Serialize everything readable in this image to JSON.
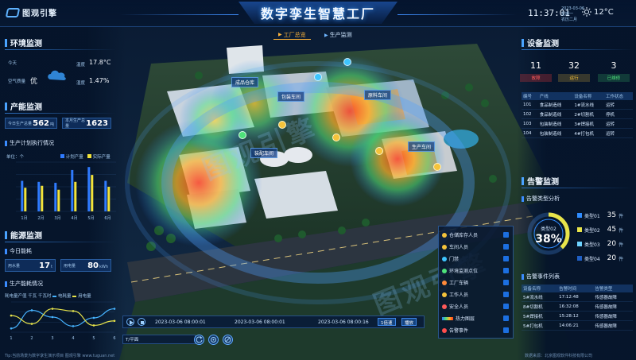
{
  "header": {
    "logo_text": "图观引擎",
    "title": "数字孪生智慧工厂",
    "time": "11:37:01",
    "date_lines": [
      "2023-03-06",
      "星期一",
      "农历二月"
    ],
    "temperature": "12°C"
  },
  "nav": {
    "tabs": [
      {
        "label": "工厂总览",
        "active": true
      },
      {
        "label": "生产监测",
        "active": false
      }
    ]
  },
  "env": {
    "title": "环境监测",
    "items": [
      {
        "label": "今天",
        "value": ""
      },
      {
        "label": "空气质量",
        "value": "优"
      },
      {
        "label": "温度",
        "value": "17.8°C"
      },
      {
        "label": "湿度",
        "value": "1.47%"
      }
    ]
  },
  "capacity": {
    "title": "产能监测",
    "today_label": "今日生产总量",
    "today_value": "562",
    "today_unit": "吨",
    "month_label": "本月生产总量",
    "month_value": "1623",
    "plan_title": "生产计划执行情况",
    "unit_label": "单位：个",
    "legend": [
      "计划产量",
      "实际产量"
    ]
  },
  "chart_bar": {
    "type": "bar",
    "categories": [
      "1月",
      "2月",
      "3月",
      "4月",
      "5月",
      "6月"
    ],
    "series": [
      {
        "name": "计划产量",
        "values": [
          62,
          60,
          58,
          84,
          90,
          62
        ]
      },
      {
        "name": "实际产量",
        "values": [
          48,
          52,
          44,
          60,
          74,
          50
        ]
      }
    ],
    "ylim": [
      0,
      100
    ],
    "colors": [
      "#2f7bff",
      "#f2e33a"
    ]
  },
  "energy": {
    "title": "能源监测",
    "today_title": "今日能耗",
    "water_label": "用水量",
    "water_value": "17",
    "water_unit": "t",
    "power_label": "用电量",
    "power_value": "80",
    "power_unit": "kWh",
    "trend_title": "生产能耗情况",
    "legend_left": "耗电量产值",
    "unit_left": "千瓦",
    "unit_right": "千瓦时",
    "legend": [
      "电耗量",
      "用电量"
    ]
  },
  "chart_line": {
    "type": "line",
    "x": [
      1,
      2,
      3,
      4,
      5,
      6
    ],
    "series": [
      {
        "name": "电耗量",
        "values": [
          10,
          58,
          40,
          16,
          38,
          62
        ]
      },
      {
        "name": "用电量",
        "values": [
          44,
          22,
          62,
          56,
          18,
          30
        ]
      }
    ],
    "ylim": [
      0,
      80
    ],
    "colors": [
      "#46b3ff",
      "#e8e44a"
    ]
  },
  "devices": {
    "title": "设备监测",
    "stats": [
      {
        "value": "11",
        "label": "故障",
        "tone": "red"
      },
      {
        "value": "32",
        "label": "运行",
        "tone": "yellow"
      },
      {
        "value": "3",
        "label": "已维修",
        "tone": "green"
      }
    ],
    "table_headers": [
      "编号",
      "产线",
      "设备名称",
      "工作状态"
    ],
    "table_rows": [
      [
        "101",
        "食品制造线",
        "1#流水线",
        "运转"
      ],
      [
        "102",
        "食品制造线",
        "2#切割机",
        "停机"
      ],
      [
        "103",
        "包装制造线",
        "3#焊接机",
        "运转"
      ],
      [
        "104",
        "包装制造线",
        "4#打包机",
        "运转"
      ]
    ]
  },
  "alarm": {
    "title": "告警监测",
    "type_title": "告警类型分析",
    "ring_label": "类型02",
    "ring_percent": "38%",
    "ring_fraction": 0.38,
    "types": [
      {
        "label": "类型01",
        "value": "35",
        "unit": "件",
        "color": "#2f8cff"
      },
      {
        "label": "类型02",
        "value": "45",
        "unit": "件",
        "color": "#e8e44a"
      },
      {
        "label": "类型03",
        "value": "20",
        "unit": "件",
        "color": "#6ed2ff"
      },
      {
        "label": "类型04",
        "value": "20",
        "unit": "件",
        "color": "#1f5fc4"
      }
    ],
    "list_title": "告警事件列表",
    "list_headers": [
      "设备名称",
      "告警时间",
      "告警类型"
    ],
    "list_rows": [
      [
        "5#流水线",
        "17:12:48",
        "传感器故障"
      ],
      [
        "8#切割机",
        "16:32:08",
        "传感器故障"
      ],
      [
        "5#焊接机",
        "15:28:12",
        "传感器故障"
      ],
      [
        "5#打包机",
        "14:06:21",
        "传感器故障"
      ]
    ]
  },
  "map": {
    "labels": [
      "成品仓库",
      "包装车间",
      "原料车间",
      "装配车间",
      "生产车间"
    ],
    "watermark": "图观引擎"
  },
  "legend_panel": {
    "items": [
      {
        "label": "仓储库存人员",
        "color": "#f5c33b"
      },
      {
        "label": "车间人员",
        "color": "#f5c33b"
      },
      {
        "label": "门禁",
        "color": "#3ec5ff"
      },
      {
        "label": "环境监测点位",
        "color": "#4ee27a"
      },
      {
        "label": "工厂车辆",
        "color": "#ff8a3a"
      },
      {
        "label": "工作人员",
        "color": "#f5c33b"
      },
      {
        "label": "安全人员",
        "color": "#ff5a5a"
      },
      {
        "label": "热力图层",
        "color": "#ff4d4d"
      },
      {
        "label": "告警事件",
        "color": "#ff4d4d"
      }
    ]
  },
  "timeline": {
    "start": "2023-03-06 08:00:01",
    "mid": "2023-03-06 08:00:01",
    "end": "2023-03-06 08:00:16",
    "speed": "1倍速",
    "mode": "播放",
    "view_mode": "T/平面"
  },
  "footer": {
    "left": "Tip:当前场景为数字孪生演示项目 图观引擎 www.tuguan.net",
    "right": "数据来源：北京图观软件科技有限公司"
  }
}
